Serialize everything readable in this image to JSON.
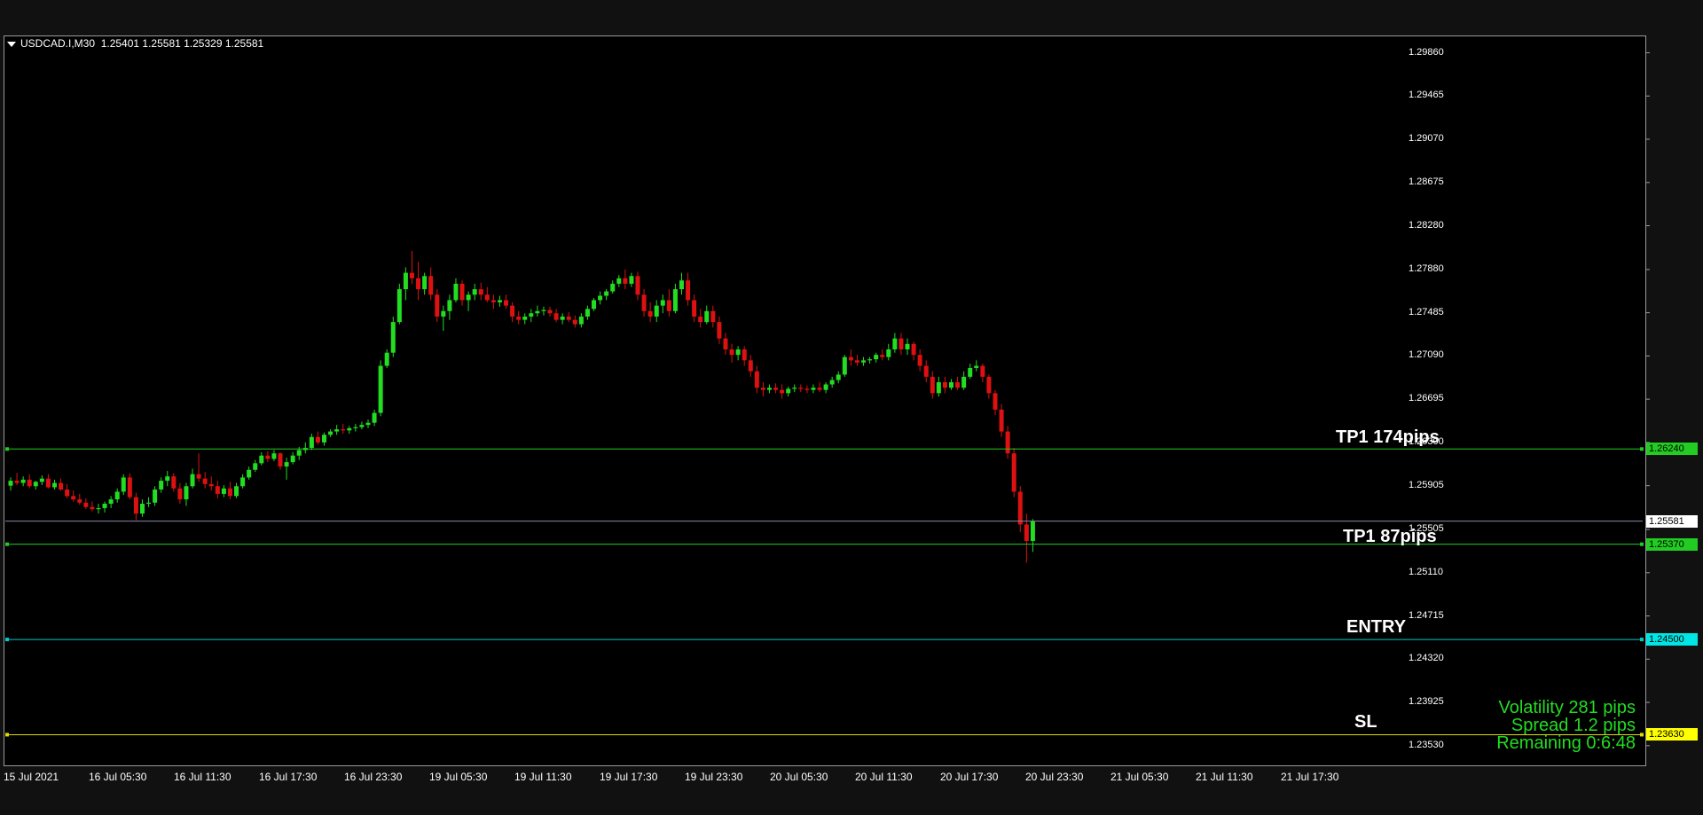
{
  "header": {
    "symbol": "USDCAD.I,M30",
    "ohlc": "1.25401 1.25581 1.25329 1.25581"
  },
  "price_axis": [
    "1.29860",
    "1.29465",
    "1.29070",
    "1.28675",
    "1.28280",
    "1.27880",
    "1.27485",
    "1.27090",
    "1.26695",
    "1.26300",
    "1.25905",
    "1.25505",
    "1.25110",
    "1.24715",
    "1.24320",
    "1.23925",
    "1.23530"
  ],
  "time_axis": [
    "15 Jul 2021",
    "16 Jul 05:30",
    "16 Jul 11:30",
    "16 Jul 17:30",
    "16 Jul 23:30",
    "19 Jul 05:30",
    "19 Jul 11:30",
    "19 Jul 17:30",
    "19 Jul 23:30",
    "20 Jul 05:30",
    "20 Jul 11:30",
    "20 Jul 17:30",
    "20 Jul 23:30",
    "21 Jul 05:30",
    "21 Jul 11:30",
    "21 Jul 17:30"
  ],
  "levels": {
    "tp1_174": {
      "label": "TP1 174pips",
      "price": "1.26240",
      "color": "#22cc22",
      "tag_bg": "#22cc22"
    },
    "current": {
      "price": "1.25581",
      "color": "#8888aa",
      "tag_bg": "#ffffff"
    },
    "tp1_87": {
      "label": "TP1 87pips",
      "price": "1.25370",
      "color": "#22cc22",
      "tag_bg": "#22cc22"
    },
    "entry": {
      "label": "ENTRY",
      "price": "1.24500",
      "color": "#00cccc",
      "tag_bg": "#00e5e5"
    },
    "sl": {
      "label": "SL",
      "price": "1.23630",
      "color": "#dddd00",
      "tag_bg": "#ffff00"
    }
  },
  "info": {
    "volatility": "Volatility  281 pips",
    "spread": "Spread  1.2 pips",
    "remaining": "Remaining  0:6:48"
  },
  "colors": {
    "bull": "#22dd22",
    "bear": "#dd1111",
    "grid_line": "#2a2a2a"
  },
  "chart_data": {
    "type": "candlestick",
    "ylim": [
      1.2335,
      1.3001
    ],
    "candles": [
      [
        1.25905,
        1.2598,
        1.2586,
        1.2595
      ],
      [
        1.2595,
        1.2602,
        1.2591,
        1.2593
      ],
      [
        1.2593,
        1.2599,
        1.259,
        1.2596
      ],
      [
        1.2596,
        1.2601,
        1.2588,
        1.259
      ],
      [
        1.259,
        1.2595,
        1.2587,
        1.2594
      ],
      [
        1.2594,
        1.26,
        1.2591,
        1.2597
      ],
      [
        1.2597,
        1.2601,
        1.2588,
        1.2589
      ],
      [
        1.2589,
        1.2596,
        1.2587,
        1.2593
      ],
      [
        1.2593,
        1.2597,
        1.2586,
        1.2587
      ],
      [
        1.2587,
        1.2592,
        1.2579,
        1.2581
      ],
      [
        1.2581,
        1.2586,
        1.2576,
        1.2578
      ],
      [
        1.2578,
        1.2583,
        1.2573,
        1.2575
      ],
      [
        1.2575,
        1.2579,
        1.2569,
        1.2571
      ],
      [
        1.2571,
        1.2576,
        1.2567,
        1.2569
      ],
      [
        1.2569,
        1.2574,
        1.2565,
        1.257
      ],
      [
        1.257,
        1.2576,
        1.2566,
        1.2574
      ],
      [
        1.2574,
        1.2581,
        1.257,
        1.2578
      ],
      [
        1.2578,
        1.2588,
        1.2575,
        1.2585
      ],
      [
        1.2585,
        1.2601,
        1.2582,
        1.2598
      ],
      [
        1.2598,
        1.2602,
        1.2578,
        1.258
      ],
      [
        1.258,
        1.2584,
        1.2559,
        1.2565
      ],
      [
        1.2565,
        1.2578,
        1.2562,
        1.2574
      ],
      [
        1.2574,
        1.258,
        1.2571,
        1.2575
      ],
      [
        1.2575,
        1.259,
        1.2572,
        1.2587
      ],
      [
        1.2587,
        1.2598,
        1.2584,
        1.2595
      ],
      [
        1.2595,
        1.2604,
        1.259,
        1.2599
      ],
      [
        1.2599,
        1.2602,
        1.2585,
        1.2588
      ],
      [
        1.2588,
        1.2593,
        1.2574,
        1.2578
      ],
      [
        1.2578,
        1.2593,
        1.2572,
        1.259
      ],
      [
        1.259,
        1.2606,
        1.2588,
        1.2601
      ],
      [
        1.2601,
        1.262,
        1.2594,
        1.2597
      ],
      [
        1.2597,
        1.2603,
        1.2588,
        1.2592
      ],
      [
        1.2592,
        1.2599,
        1.2586,
        1.259
      ],
      [
        1.259,
        1.2595,
        1.2579,
        1.2583
      ],
      [
        1.2583,
        1.2591,
        1.258,
        1.2588
      ],
      [
        1.2588,
        1.2594,
        1.2578,
        1.2581
      ],
      [
        1.2581,
        1.2593,
        1.2579,
        1.259
      ],
      [
        1.259,
        1.2601,
        1.2588,
        1.2598
      ],
      [
        1.2598,
        1.2608,
        1.2596,
        1.2605
      ],
      [
        1.2605,
        1.2614,
        1.2603,
        1.2611
      ],
      [
        1.2611,
        1.2621,
        1.2609,
        1.2618
      ],
      [
        1.2618,
        1.2622,
        1.2612,
        1.2615
      ],
      [
        1.2615,
        1.2623,
        1.2613,
        1.262
      ],
      [
        1.262,
        1.2621,
        1.2605,
        1.2608
      ],
      [
        1.2608,
        1.2616,
        1.2596,
        1.2612
      ],
      [
        1.2612,
        1.2621,
        1.261,
        1.2618
      ],
      [
        1.2618,
        1.2626,
        1.2614,
        1.2623
      ],
      [
        1.2623,
        1.263,
        1.262,
        1.2625
      ],
      [
        1.2625,
        1.2638,
        1.2623,
        1.2635
      ],
      [
        1.2635,
        1.264,
        1.2628,
        1.263
      ],
      [
        1.263,
        1.2639,
        1.2627,
        1.2637
      ],
      [
        1.2637,
        1.2642,
        1.2635,
        1.264
      ],
      [
        1.264,
        1.2646,
        1.2637,
        1.2642
      ],
      [
        1.2642,
        1.2647,
        1.2638,
        1.2641
      ],
      [
        1.2641,
        1.2645,
        1.2638,
        1.2643
      ],
      [
        1.2643,
        1.2647,
        1.264,
        1.2644
      ],
      [
        1.2644,
        1.2649,
        1.2642,
        1.2646
      ],
      [
        1.2646,
        1.2651,
        1.2643,
        1.2648
      ],
      [
        1.2648,
        1.266,
        1.2645,
        1.2657
      ],
      [
        1.2657,
        1.2705,
        1.2654,
        1.27
      ],
      [
        1.27,
        1.2715,
        1.2698,
        1.2712
      ],
      [
        1.2712,
        1.2745,
        1.2708,
        1.274
      ],
      [
        1.274,
        1.2775,
        1.2738,
        1.277
      ],
      [
        1.277,
        1.279,
        1.276,
        1.2785
      ],
      [
        1.2785,
        1.2805,
        1.2775,
        1.278
      ],
      [
        1.278,
        1.2795,
        1.276,
        1.277
      ],
      [
        1.277,
        1.2785,
        1.2765,
        1.2782
      ],
      [
        1.2782,
        1.279,
        1.276,
        1.2765
      ],
      [
        1.2765,
        1.277,
        1.274,
        1.2745
      ],
      [
        1.2745,
        1.2755,
        1.2732,
        1.275
      ],
      [
        1.275,
        1.2765,
        1.2742,
        1.276
      ],
      [
        1.276,
        1.278,
        1.2758,
        1.2775
      ],
      [
        1.2775,
        1.2778,
        1.2755,
        1.276
      ],
      [
        1.276,
        1.2768,
        1.275,
        1.2765
      ],
      [
        1.2765,
        1.2775,
        1.276,
        1.277
      ],
      [
        1.277,
        1.2776,
        1.276,
        1.2765
      ],
      [
        1.2765,
        1.2772,
        1.2758,
        1.276
      ],
      [
        1.276,
        1.2765,
        1.2752,
        1.2758
      ],
      [
        1.2758,
        1.2764,
        1.2754,
        1.276
      ],
      [
        1.276,
        1.2765,
        1.2752,
        1.2755
      ],
      [
        1.2755,
        1.2758,
        1.274,
        1.2745
      ],
      [
        1.2745,
        1.275,
        1.2738,
        1.2742
      ],
      [
        1.2742,
        1.2748,
        1.2738,
        1.2745
      ],
      [
        1.2745,
        1.2752,
        1.274,
        1.2748
      ],
      [
        1.2748,
        1.2755,
        1.2745,
        1.275
      ],
      [
        1.275,
        1.2754,
        1.2746,
        1.2751
      ],
      [
        1.2751,
        1.2754,
        1.2745,
        1.2748
      ],
      [
        1.2748,
        1.2752,
        1.274,
        1.2742
      ],
      [
        1.2742,
        1.2748,
        1.2738,
        1.2745
      ],
      [
        1.2745,
        1.2749,
        1.274,
        1.2742
      ],
      [
        1.2742,
        1.2746,
        1.2735,
        1.2738
      ],
      [
        1.2738,
        1.2748,
        1.2735,
        1.2745
      ],
      [
        1.2745,
        1.2755,
        1.2742,
        1.2752
      ],
      [
        1.2752,
        1.2762,
        1.275,
        1.276
      ],
      [
        1.276,
        1.2768,
        1.2756,
        1.2764
      ],
      [
        1.2764,
        1.277,
        1.276,
        1.2768
      ],
      [
        1.2768,
        1.2778,
        1.2766,
        1.2775
      ],
      [
        1.2775,
        1.2783,
        1.2772,
        1.278
      ],
      [
        1.278,
        1.2788,
        1.277,
        1.2775
      ],
      [
        1.2775,
        1.2785,
        1.2772,
        1.2782
      ],
      [
        1.2782,
        1.2786,
        1.276,
        1.2765
      ],
      [
        1.2765,
        1.277,
        1.2745,
        1.275
      ],
      [
        1.275,
        1.2758,
        1.274,
        1.2745
      ],
      [
        1.2745,
        1.276,
        1.274,
        1.2755
      ],
      [
        1.2755,
        1.2765,
        1.2748,
        1.276
      ],
      [
        1.276,
        1.277,
        1.2745,
        1.275
      ],
      [
        1.275,
        1.2775,
        1.2748,
        1.277
      ],
      [
        1.277,
        1.2785,
        1.2765,
        1.2778
      ],
      [
        1.2778,
        1.2785,
        1.2755,
        1.276
      ],
      [
        1.276,
        1.2765,
        1.274,
        1.2745
      ],
      [
        1.2745,
        1.2752,
        1.2735,
        1.274
      ],
      [
        1.274,
        1.2755,
        1.2738,
        1.275
      ],
      [
        1.275,
        1.2755,
        1.2735,
        1.274
      ],
      [
        1.274,
        1.2745,
        1.272,
        1.2725
      ],
      [
        1.2725,
        1.273,
        1.271,
        1.2715
      ],
      [
        1.2715,
        1.272,
        1.2703,
        1.271
      ],
      [
        1.271,
        1.2718,
        1.2705,
        1.2715
      ],
      [
        1.2715,
        1.2718,
        1.27,
        1.2705
      ],
      [
        1.2705,
        1.271,
        1.269,
        1.2695
      ],
      [
        1.2695,
        1.27,
        1.2675,
        1.268
      ],
      [
        1.268,
        1.2685,
        1.2672,
        1.2678
      ],
      [
        1.2678,
        1.2683,
        1.2675,
        1.268
      ],
      [
        1.268,
        1.2684,
        1.2675,
        1.2678
      ],
      [
        1.2678,
        1.2683,
        1.267,
        1.2675
      ],
      [
        1.2675,
        1.2681,
        1.2672,
        1.2679
      ],
      [
        1.2679,
        1.2683,
        1.2676,
        1.268
      ],
      [
        1.268,
        1.2683,
        1.2676,
        1.2679
      ],
      [
        1.2679,
        1.2682,
        1.2675,
        1.2678
      ],
      [
        1.2678,
        1.2683,
        1.2675,
        1.268
      ],
      [
        1.268,
        1.2685,
        1.2676,
        1.2678
      ],
      [
        1.2678,
        1.2685,
        1.2675,
        1.2683
      ],
      [
        1.2683,
        1.269,
        1.268,
        1.2687
      ],
      [
        1.2687,
        1.2695,
        1.2684,
        1.2692
      ],
      [
        1.2692,
        1.271,
        1.269,
        1.2708
      ],
      [
        1.2708,
        1.2715,
        1.27,
        1.2705
      ],
      [
        1.2705,
        1.271,
        1.27,
        1.2703
      ],
      [
        1.2703,
        1.2708,
        1.27,
        1.2705
      ],
      [
        1.2705,
        1.2708,
        1.2702,
        1.2706
      ],
      [
        1.2706,
        1.2712,
        1.2703,
        1.271
      ],
      [
        1.271,
        1.2715,
        1.2705,
        1.2708
      ],
      [
        1.2708,
        1.272,
        1.2705,
        1.2715
      ],
      [
        1.2715,
        1.273,
        1.2712,
        1.2725
      ],
      [
        1.2725,
        1.273,
        1.271,
        1.2715
      ],
      [
        1.2715,
        1.2725,
        1.271,
        1.272
      ],
      [
        1.272,
        1.2722,
        1.2705,
        1.271
      ],
      [
        1.271,
        1.2715,
        1.2695,
        1.27
      ],
      [
        1.27,
        1.2705,
        1.2685,
        1.269
      ],
      [
        1.269,
        1.2695,
        1.267,
        1.2675
      ],
      [
        1.2675,
        1.269,
        1.2672,
        1.2685
      ],
      [
        1.2685,
        1.269,
        1.2675,
        1.268
      ],
      [
        1.268,
        1.2688,
        1.2678,
        1.2685
      ],
      [
        1.2685,
        1.269,
        1.2678,
        1.268
      ],
      [
        1.268,
        1.2695,
        1.2678,
        1.269
      ],
      [
        1.269,
        1.2702,
        1.2688,
        1.2698
      ],
      [
        1.2698,
        1.2705,
        1.2695,
        1.27
      ],
      [
        1.27,
        1.2702,
        1.2685,
        1.269
      ],
      [
        1.269,
        1.2692,
        1.267,
        1.2675
      ],
      [
        1.2675,
        1.2678,
        1.2655,
        1.266
      ],
      [
        1.266,
        1.2665,
        1.2635,
        1.264
      ],
      [
        1.264,
        1.2645,
        1.2615,
        1.262
      ],
      [
        1.262,
        1.2625,
        1.258,
        1.2585
      ],
      [
        1.2585,
        1.259,
        1.2548,
        1.2555
      ],
      [
        1.2555,
        1.2565,
        1.252,
        1.254
      ],
      [
        1.254,
        1.256,
        1.253,
        1.25581
      ]
    ]
  }
}
